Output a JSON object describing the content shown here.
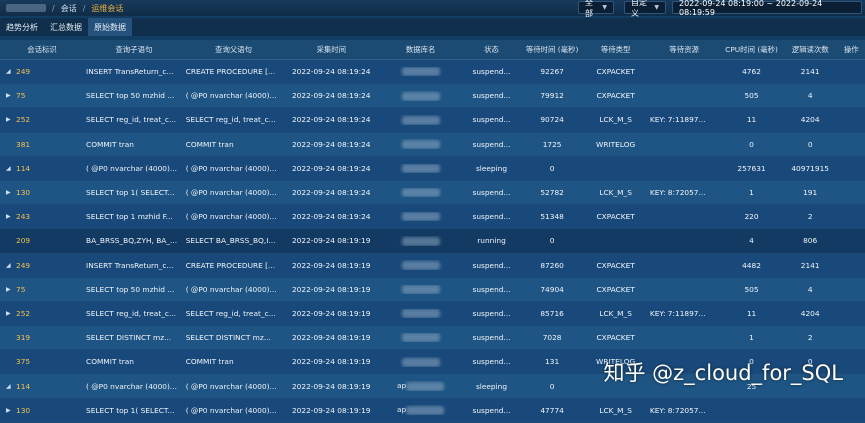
{
  "topbar": {
    "crumbs": [
      "会话",
      "运维会话"
    ],
    "scope_select": "全部",
    "range_select": "自定义",
    "date_range": "2022-09-24 08:19:00 ~ 2022-09-24 08:19:59"
  },
  "tabs": [
    {
      "label": "趋势分析",
      "active": false
    },
    {
      "label": "汇总数据",
      "active": false
    },
    {
      "label": "原始数据",
      "active": true
    }
  ],
  "table": {
    "headers": [
      "会话标识",
      "查询子语句",
      "查询父语句",
      "采集时间",
      "数据库名",
      "状态",
      "等待时间 (毫秒)",
      "等待类型",
      "等待资源",
      "CPU时间 (毫秒)",
      "逻辑读次数",
      "操作"
    ],
    "rows": [
      {
        "expand": "◢",
        "sid": "249",
        "q1": "INSERT TransReturn_c...",
        "q2": "CREATE PROCEDURE [...",
        "time": "2022-09-24 08:19:24",
        "db_prefix": "",
        "status": "suspend...",
        "wait": "92267",
        "wtype": "CXPACKET",
        "wres": "",
        "cpu": "4762",
        "lr": "2141"
      },
      {
        "expand": "▶",
        "sid": "75",
        "q1": "SELECT top 50 mzhid ...",
        "q2": "( @P0 nvarchar (4000)...",
        "time": "2022-09-24 08:19:24",
        "db_prefix": "",
        "status": "suspend...",
        "wait": "79912",
        "wtype": "CXPACKET",
        "wres": "",
        "cpu": "505",
        "lr": "4"
      },
      {
        "expand": "▶",
        "sid": "252",
        "q1": "SELECT reg_id, treat_c...",
        "q2": "SELECT reg_id, treat_c...",
        "time": "2022-09-24 08:19:24",
        "db_prefix": "",
        "status": "suspend...",
        "wait": "90724",
        "wtype": "LCK_M_S",
        "wres": "KEY: 7:11897...",
        "cpu": "11",
        "lr": "4204"
      },
      {
        "expand": "",
        "sid": "381",
        "q1": "COMMIT tran",
        "q2": "COMMIT tran",
        "time": "2022-09-24 08:19:24",
        "db_prefix": "",
        "status": "suspend...",
        "wait": "1725",
        "wtype": "WRITELOG",
        "wres": "",
        "cpu": "0",
        "lr": "0"
      },
      {
        "expand": "◢",
        "sid": "114",
        "q1": "( @P0 nvarchar (4000)...",
        "q2": "( @P0 nvarchar (4000)...",
        "time": "2022-09-24 08:19:24",
        "db_prefix": "",
        "status": "sleeping",
        "wait": "0",
        "wtype": "",
        "wres": "",
        "cpu": "257631",
        "lr": "40971915"
      },
      {
        "expand": "▶",
        "sid": "130",
        "q1": "SELECT top 1( SELECT...",
        "q2": "( @P0 nvarchar (4000)...",
        "time": "2022-09-24 08:19:24",
        "db_prefix": "",
        "status": "suspend...",
        "wait": "52782",
        "wtype": "LCK_M_S",
        "wres": "KEY: 8:72057...",
        "cpu": "1",
        "lr": "191"
      },
      {
        "expand": "▶",
        "sid": "243",
        "q1": "SELECT top 1 mzhid F...",
        "q2": "( @P0 nvarchar (4000)...",
        "time": "2022-09-24 08:19:24",
        "db_prefix": "",
        "status": "suspend...",
        "wait": "51348",
        "wtype": "CXPACKET",
        "wres": "",
        "cpu": "220",
        "lr": "2"
      },
      {
        "expand": "",
        "sid": "209",
        "q1": "BA_BRSS_BQ,ZYH, BA_...",
        "q2": "SELECT BA_BRSS_BQ,I...",
        "time": "2022-09-24 08:19:19",
        "db_prefix": "",
        "status": "running",
        "wait": "0",
        "wtype": "",
        "wres": "",
        "cpu": "4",
        "lr": "806"
      },
      {
        "expand": "◢",
        "sid": "249",
        "q1": "INSERT TransReturn_c...",
        "q2": "CREATE PROCEDURE [...",
        "time": "2022-09-24 08:19:19",
        "db_prefix": "",
        "status": "suspend...",
        "wait": "87260",
        "wtype": "CXPACKET",
        "wres": "",
        "cpu": "4482",
        "lr": "2141"
      },
      {
        "expand": "▶",
        "sid": "75",
        "q1": "SELECT top 50 mzhid ...",
        "q2": "( @P0 nvarchar (4000)...",
        "time": "2022-09-24 08:19:19",
        "db_prefix": "",
        "status": "suspend...",
        "wait": "74904",
        "wtype": "CXPACKET",
        "wres": "",
        "cpu": "505",
        "lr": "4"
      },
      {
        "expand": "▶",
        "sid": "252",
        "q1": "SELECT reg_id, treat_c...",
        "q2": "SELECT reg_id, treat_c...",
        "time": "2022-09-24 08:19:19",
        "db_prefix": "",
        "status": "suspend...",
        "wait": "85716",
        "wtype": "LCK_M_S",
        "wres": "KEY: 7:11897...",
        "cpu": "11",
        "lr": "4204"
      },
      {
        "expand": "",
        "sid": "319",
        "q1": "SELECT DISTINCT mz...",
        "q2": "SELECT DISTINCT mz...",
        "time": "2022-09-24 08:19:19",
        "db_prefix": "",
        "status": "suspend...",
        "wait": "7028",
        "wtype": "CXPACKET",
        "wres": "",
        "cpu": "1",
        "lr": "2"
      },
      {
        "expand": "",
        "sid": "375",
        "q1": "COMMIT tran",
        "q2": "COMMIT tran",
        "time": "2022-09-24 08:19:19",
        "db_prefix": "",
        "status": "suspend...",
        "wait": "131",
        "wtype": "WRITELOG",
        "wres": "",
        "cpu": "0",
        "lr": "0"
      },
      {
        "expand": "◢",
        "sid": "114",
        "q1": "( @P0 nvarchar (4000)...",
        "q2": "( @P0 nvarchar (4000)...",
        "time": "2022-09-24 08:19:19",
        "db_prefix": "ap",
        "status": "sleeping",
        "wait": "0",
        "wtype": "",
        "wres": "",
        "cpu": "25",
        "lr": ""
      },
      {
        "expand": "▶",
        "sid": "130",
        "q1": "SELECT top 1( SELECT...",
        "q2": "( @P0 nvarchar (4000)...",
        "time": "2022-09-24 08:19:19",
        "db_prefix": "ap",
        "status": "suspend...",
        "wait": "47774",
        "wtype": "LCK_M_S",
        "wres": "KEY: 8:72057...",
        "cpu": "",
        "lr": ""
      }
    ]
  },
  "watermark": "知乎 @z_cloud_for_SQL"
}
